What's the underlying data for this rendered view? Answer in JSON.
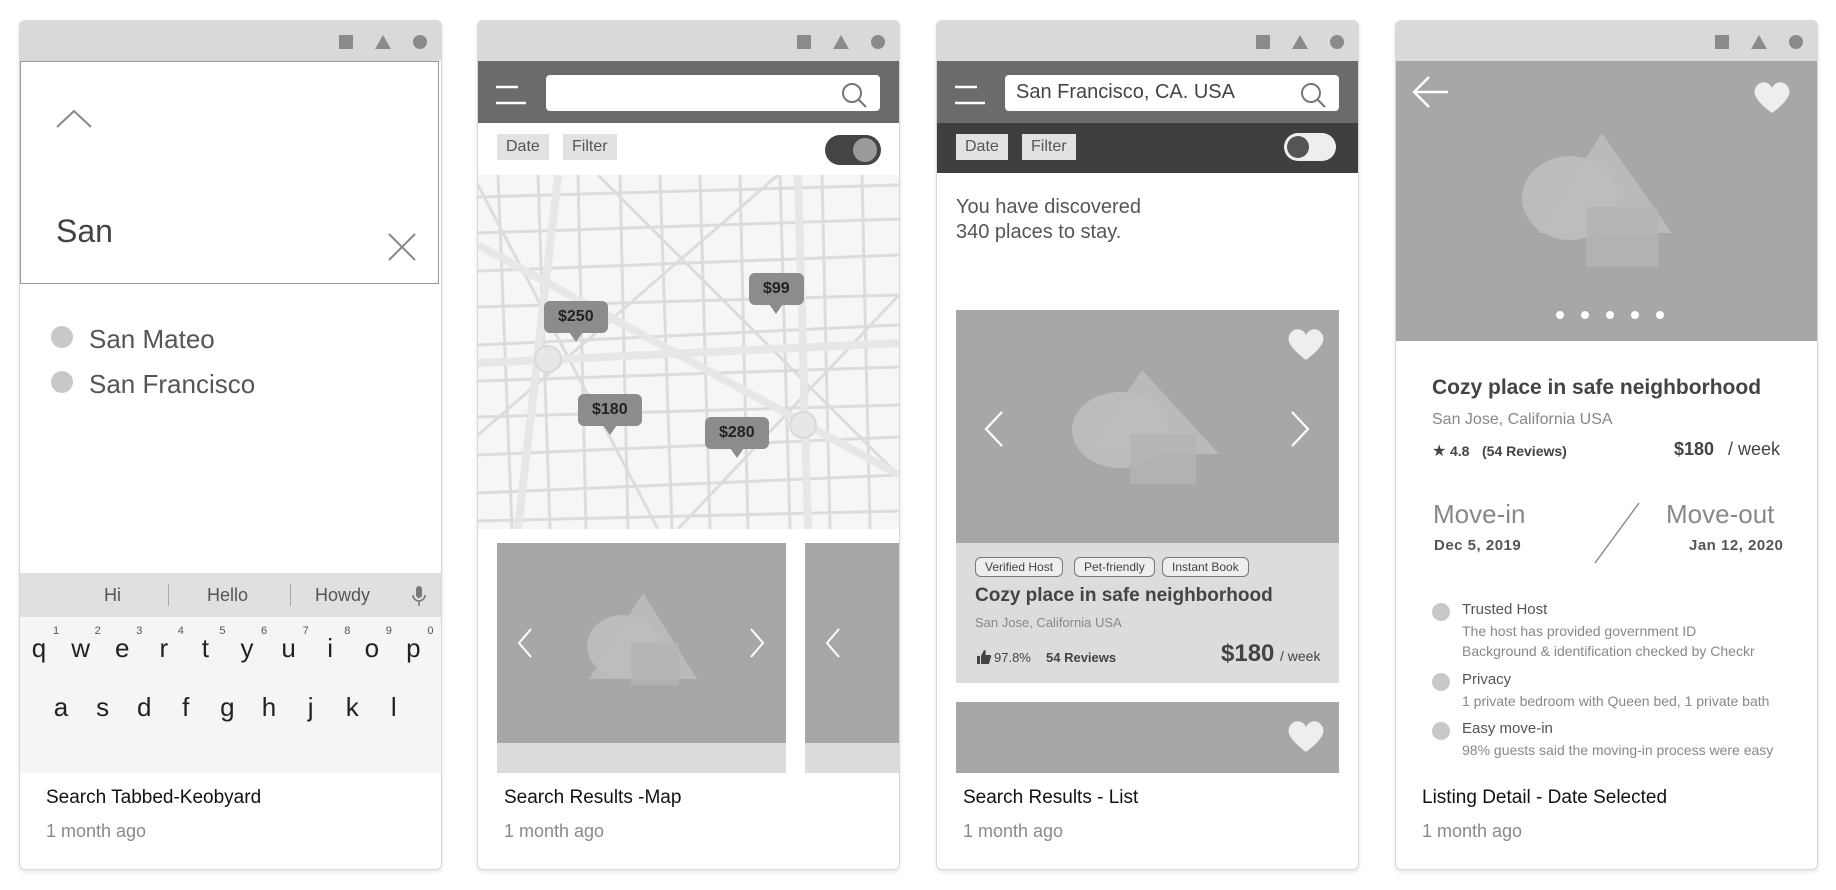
{
  "cards": [
    {
      "caption": "Search Tabbed-Keobyard",
      "time": "1 month ago",
      "search_value": "San",
      "suggestions": [
        "San Mateo",
        "San Francisco"
      ],
      "keyboard": {
        "suggestions": [
          "Hi",
          "Hello",
          "Howdy"
        ],
        "row1": [
          "q",
          "w",
          "e",
          "r",
          "t",
          "y",
          "u",
          "i",
          "o",
          "p"
        ],
        "row1_numbers": [
          "1",
          "2",
          "3",
          "4",
          "5",
          "6",
          "7",
          "8",
          "9",
          "0"
        ],
        "row2": [
          "a",
          "s",
          "d",
          "f",
          "g",
          "h",
          "j",
          "k",
          "l"
        ]
      }
    },
    {
      "caption": "Search Results -Map",
      "time": "1 month ago",
      "filters": [
        "Date",
        "Filter"
      ],
      "pins": [
        "$250",
        "$99",
        "$180",
        "$280"
      ]
    },
    {
      "caption": "Search Results - List",
      "time": "1 month ago",
      "search_value": "San Francisco, CA. USA",
      "filters": [
        "Date",
        "Filter"
      ],
      "heading": "You have discovered 340 places to stay.",
      "listing": {
        "tags": [
          "Verified Host",
          "Pet-friendly",
          "Instant Book"
        ],
        "title": "Cozy place in safe neighborhood",
        "location": "San Jose, California USA",
        "rating": "97.8%",
        "reviews": "54 Reviews",
        "price": "$180",
        "period": "/ week"
      }
    },
    {
      "caption": "Listing Detail - Date Selected",
      "time": "1 month ago",
      "title": "Cozy place in safe neighborhood",
      "location": "San Jose, California USA",
      "rating": "4.8",
      "reviews": "(54 Reviews)",
      "price": "$180",
      "period": "/ week",
      "movein_label": "Move-in",
      "movein_date": "Dec 5, 2019",
      "moveout_label": "Move-out",
      "moveout_date": "Jan 12, 2020",
      "features": [
        {
          "title": "Trusted Host",
          "desc": [
            "The host has provided government ID",
            "Background & identification checked by Checkr"
          ]
        },
        {
          "title": "Privacy",
          "desc": [
            "1 private bedroom with Queen bed, 1 private bath"
          ]
        },
        {
          "title": "Easy move-in",
          "desc": [
            "98% guests said the moving-in process were easy"
          ]
        }
      ]
    }
  ]
}
